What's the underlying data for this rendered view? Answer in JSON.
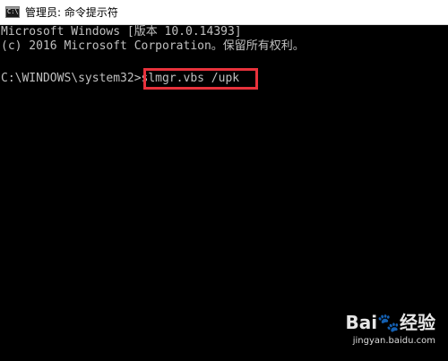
{
  "window": {
    "icon_label": "C:\\.",
    "title": "管理员: 命令提示符"
  },
  "console": {
    "lines": [
      "Microsoft Windows [版本 10.0.14393]",
      "(c) 2016 Microsoft Corporation。保留所有权利。",
      "",
      "C:\\WINDOWS\\system32>slmgr.vbs /upk"
    ],
    "prompt": "C:\\WINDOWS\\system32>",
    "command": "slmgr.vbs /upk",
    "highlight_color": "#e8323c",
    "text_color": "#c0c0c0",
    "background": "#000000"
  },
  "watermark": {
    "logo": "Bai🐾经验",
    "url": "jingyan.baidu.com"
  }
}
